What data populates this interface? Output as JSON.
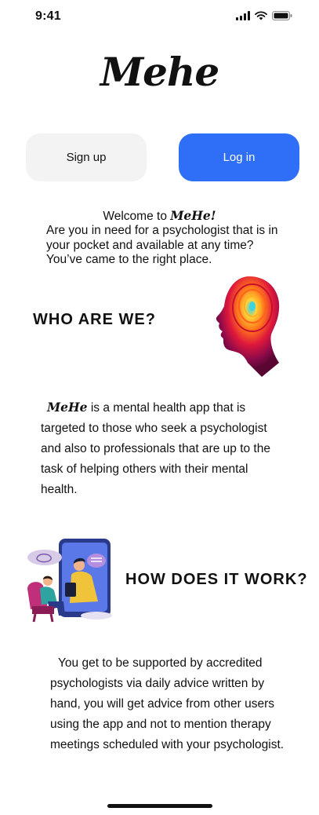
{
  "status_bar": {
    "time": "9:41",
    "icons": [
      "cellular-signal-icon",
      "wifi-icon",
      "battery-icon"
    ]
  },
  "logo": "Mehe",
  "buttons": {
    "signup": "Sign up",
    "login": "Log in"
  },
  "welcome": {
    "prefix": "Welcome to ",
    "brand": "MeHe!",
    "intro": "Are you in need for a psychologist that is in your pocket and available at any time? You’ve came to the right place."
  },
  "who_are_we": {
    "heading": "WHO ARE WE?",
    "brand": "MeHe",
    "body": " is a mental health app that is targeted to those who seek a psychologist and also to professionals that are up to the task of helping others with their mental health."
  },
  "how_it_works": {
    "heading": "HOW DOES IT WORK?",
    "body": "You get to be supported by accredited psychologists via daily advice written by hand, you will get advice from other users using the app and not to mention therapy meetings scheduled with your psychologist."
  },
  "colors": {
    "primary": "#2f6ef7",
    "secondary_button": "#f3f3f3"
  }
}
